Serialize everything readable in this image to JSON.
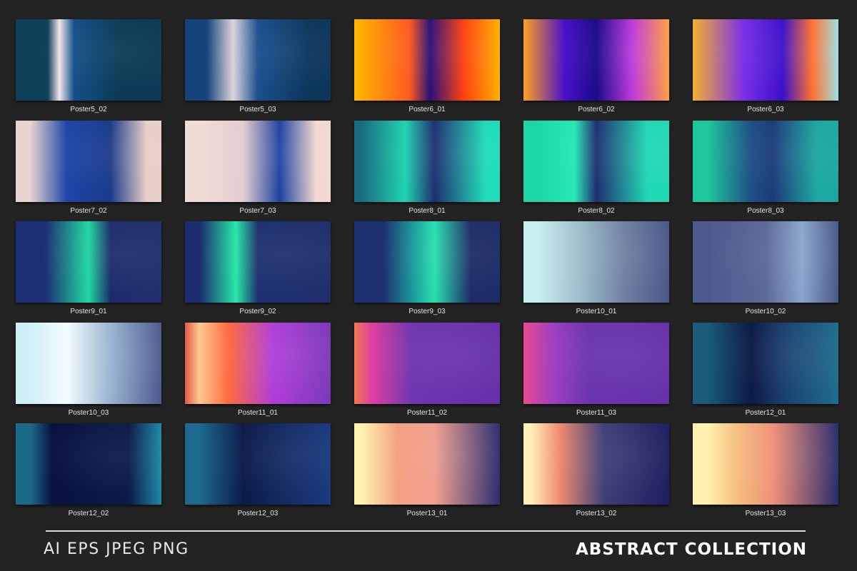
{
  "posters": [
    {
      "label": "Poster5_02",
      "colors": [
        "#0e4058",
        "#f0e6ea",
        "#14508c",
        "#0a3a55"
      ],
      "stops": [
        22,
        30,
        40,
        70
      ]
    },
    {
      "label": "Poster5_03",
      "colors": [
        "#14447a",
        "#dcd4dc",
        "#1a4f8f",
        "#0c355a"
      ],
      "stops": [
        15,
        33,
        50,
        85
      ]
    },
    {
      "label": "Poster6_01",
      "colors": [
        "#ffb800",
        "#ff5a20",
        "#2a1078",
        "#ff4010",
        "#ffb000"
      ],
      "stops": [
        0,
        38,
        52,
        75,
        100
      ]
    },
    {
      "label": "Poster6_02",
      "colors": [
        "#ffa020",
        "#4a10c8",
        "#1a0a8a",
        "#c03adc",
        "#ffa040"
      ],
      "stops": [
        0,
        28,
        50,
        75,
        100
      ]
    },
    {
      "label": "Poster6_03",
      "colors": [
        "#f5b030",
        "#7a2ee8",
        "#3a10c8",
        "#ff7030",
        "#9ee0e0"
      ],
      "stops": [
        0,
        35,
        62,
        82,
        100
      ]
    },
    {
      "label": "Poster7_02",
      "colors": [
        "#e8d4d0",
        "#1e46a8",
        "#1a3a8a",
        "#e8cfc8"
      ],
      "stops": [
        10,
        35,
        65,
        90
      ]
    },
    {
      "label": "Poster7_03",
      "colors": [
        "#f2dcd6",
        "#e4cdd0",
        "#1e42a0",
        "#f2d8d0"
      ],
      "stops": [
        10,
        40,
        65,
        90
      ]
    },
    {
      "label": "Poster8_01",
      "colors": [
        "#1a6c80",
        "#20d4b0",
        "#1e2f72",
        "#20dcb8"
      ],
      "stops": [
        5,
        35,
        55,
        90
      ]
    },
    {
      "label": "Poster8_02",
      "colors": [
        "#1cd6a6",
        "#28e8b8",
        "#1e2f72",
        "#20d8b4"
      ],
      "stops": [
        10,
        35,
        50,
        85
      ]
    },
    {
      "label": "Poster8_03",
      "colors": [
        "#1ec89c",
        "#1e4f86",
        "#1c3a7a",
        "#1ca8a0"
      ],
      "stops": [
        10,
        40,
        55,
        85
      ]
    },
    {
      "label": "Poster9_01",
      "colors": [
        "#1e2e74",
        "#20d8a0",
        "#1c2c6c",
        "#20306c"
      ],
      "stops": [
        20,
        50,
        65,
        90
      ]
    },
    {
      "label": "Poster9_02",
      "colors": [
        "#1c2c6e",
        "#28e8a8",
        "#1e3070",
        "#1e2f6c"
      ],
      "stops": [
        10,
        35,
        50,
        90
      ]
    },
    {
      "label": "Poster9_03",
      "colors": [
        "#1e2f70",
        "#1a9a9a",
        "#28e0b0",
        "#1e2c68"
      ],
      "stops": [
        20,
        40,
        55,
        80
      ]
    },
    {
      "label": "Poster10_01",
      "colors": [
        "#c8eef0",
        "#9cbcc8",
        "#6e7ea0",
        "#4a5888"
      ],
      "stops": [
        10,
        40,
        70,
        100
      ]
    },
    {
      "label": "Poster10_02",
      "colors": [
        "#4e5a8c",
        "#5c6898",
        "#8aa6cc",
        "#4a5888"
      ],
      "stops": [
        10,
        50,
        75,
        100
      ]
    },
    {
      "label": "Poster10_03",
      "colors": [
        "#d0f0f8",
        "#f4fcff",
        "#9ab4d0",
        "#4e5a8e"
      ],
      "stops": [
        10,
        35,
        65,
        100
      ]
    },
    {
      "label": "Poster11_01",
      "colors": [
        "#e05a4a",
        "#ffc890",
        "#ff6a40",
        "#b03ed8",
        "#7a3ab8"
      ],
      "stops": [
        0,
        10,
        30,
        60,
        100
      ]
    },
    {
      "label": "Poster11_02",
      "colors": [
        "#f07850",
        "#e040a0",
        "#6e36b0",
        "#6630aa"
      ],
      "stops": [
        0,
        12,
        40,
        100
      ]
    },
    {
      "label": "Poster11_03",
      "colors": [
        "#e84a90",
        "#a040c0",
        "#6a34ae",
        "#6632aa"
      ],
      "stops": [
        0,
        20,
        45,
        100
      ]
    },
    {
      "label": "Poster12_01",
      "colors": [
        "#1a5c7a",
        "#0c1a44",
        "#1a3c6c",
        "#1e6e8e"
      ],
      "stops": [
        10,
        40,
        60,
        100
      ]
    },
    {
      "label": "Poster12_02",
      "colors": [
        "#1a6a88",
        "#0a1240",
        "#0c1a48",
        "#1e8aa8"
      ],
      "stops": [
        10,
        25,
        78,
        100
      ]
    },
    {
      "label": "Poster12_03",
      "colors": [
        "#1e6a8e",
        "#0c1a48",
        "#142c64",
        "#1a3a80"
      ],
      "stops": [
        10,
        40,
        70,
        100
      ]
    },
    {
      "label": "Poster13_01",
      "colors": [
        "#fff4b0",
        "#f4a080",
        "#f0a090",
        "#2c2e70"
      ],
      "stops": [
        5,
        30,
        55,
        100
      ]
    },
    {
      "label": "Poster13_02",
      "colors": [
        "#fff0b8",
        "#f08a70",
        "#404078",
        "#1c1e60"
      ],
      "stops": [
        5,
        25,
        55,
        100
      ]
    },
    {
      "label": "Poster13_03",
      "colors": [
        "#fff2b0",
        "#f4c080",
        "#f0907a",
        "#2a2c6c"
      ],
      "stops": [
        10,
        30,
        55,
        100
      ]
    }
  ],
  "footer": {
    "formats": "AI EPS JPEG PNG",
    "title": "ABSTRACT COLLECTION"
  },
  "colors": {
    "background": "#232323",
    "caption": "#e6e6e6",
    "rule": "#dcdcdc"
  }
}
